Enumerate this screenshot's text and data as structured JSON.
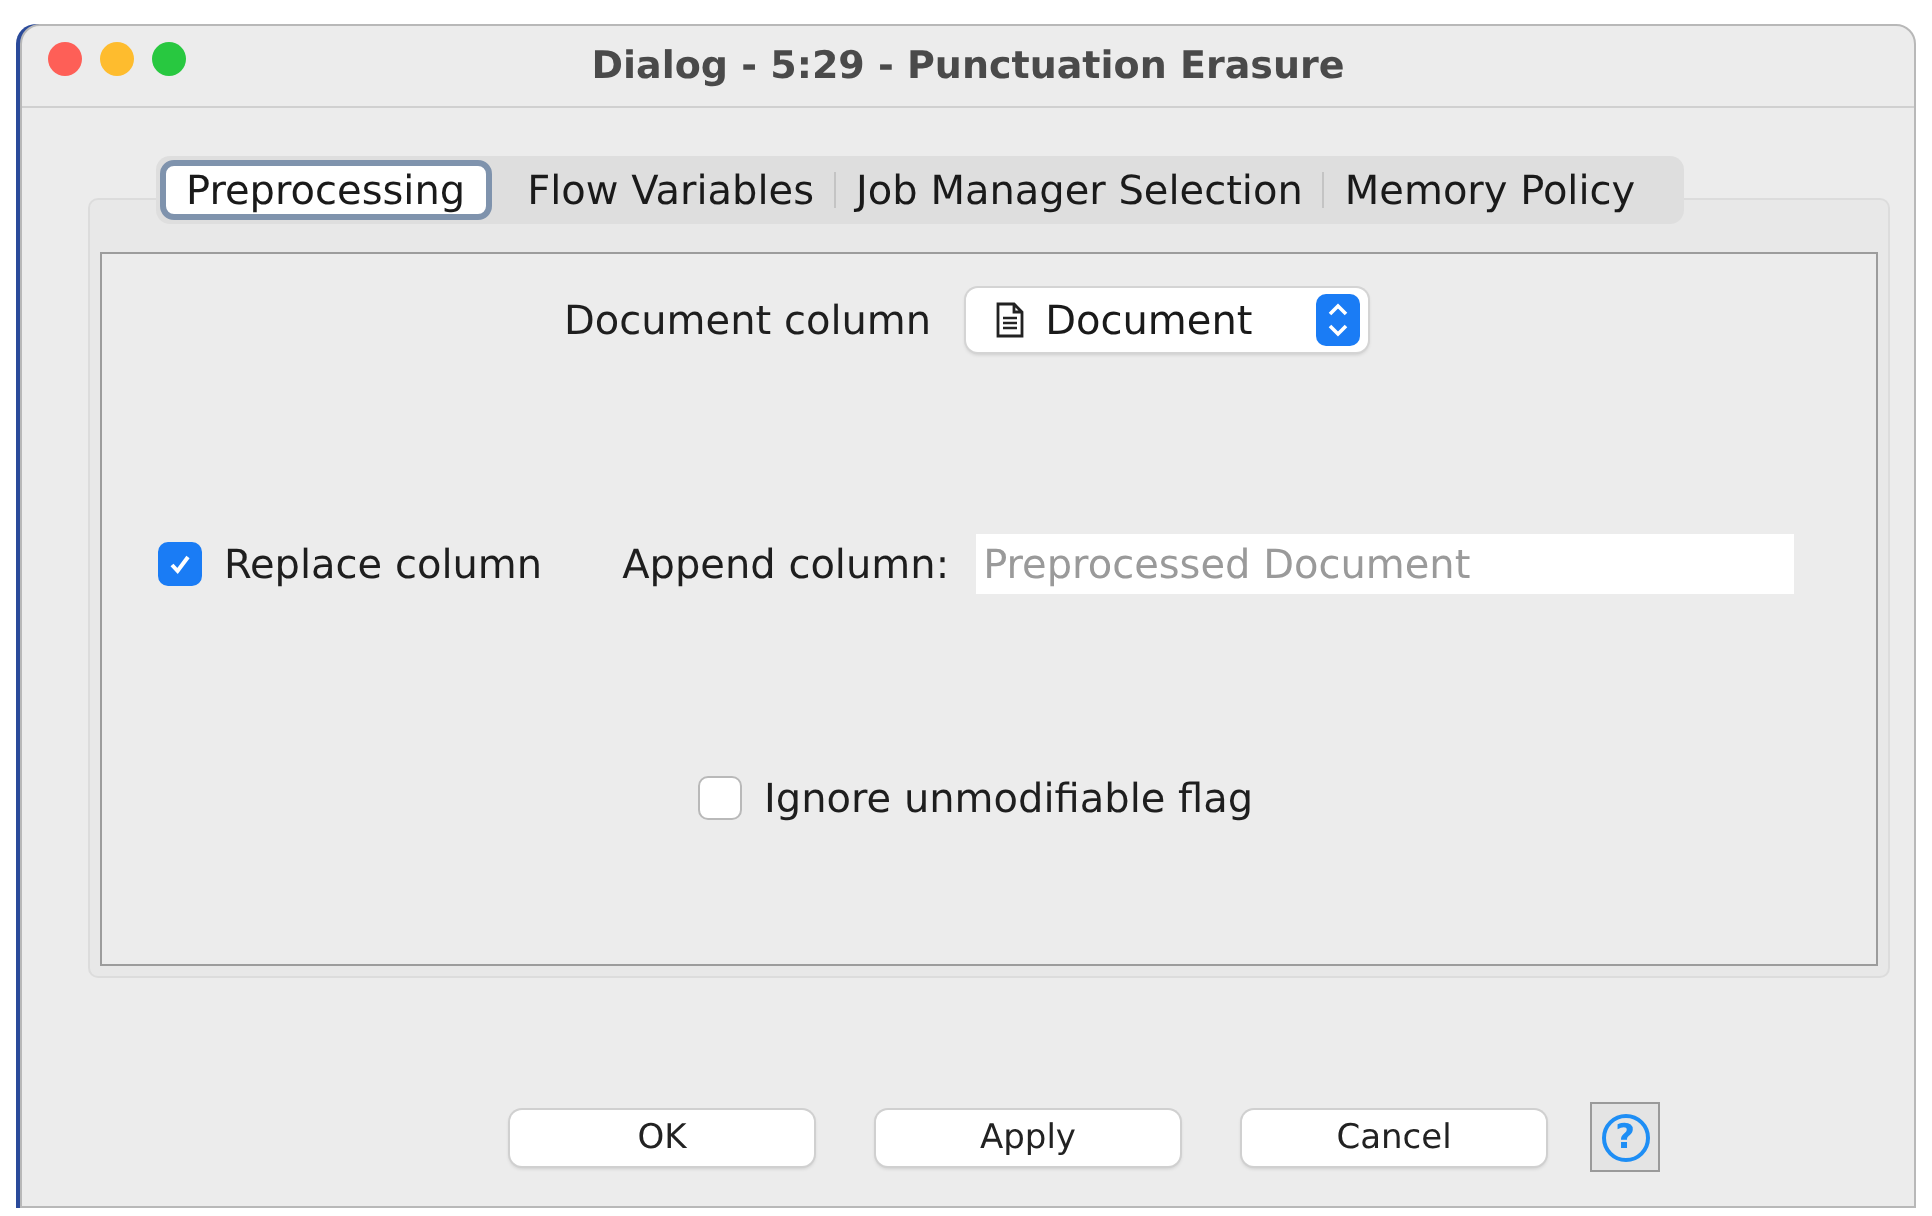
{
  "window": {
    "title": "Dialog - 5:29 - Punctuation Erasure"
  },
  "tabs": [
    {
      "label": "Preprocessing",
      "selected": true
    },
    {
      "label": "Flow Variables",
      "selected": false
    },
    {
      "label": "Job Manager Selection",
      "selected": false
    },
    {
      "label": "Memory Policy",
      "selected": false
    }
  ],
  "document_column": {
    "label": "Document column",
    "value": "Document"
  },
  "replace_column": {
    "label": "Replace column",
    "checked": true
  },
  "append_column": {
    "label": "Append column:",
    "placeholder": "Preprocessed Document"
  },
  "ignore_flag": {
    "label": "Ignore unmodifiable flag",
    "checked": false
  },
  "buttons": [
    {
      "label": "OK"
    },
    {
      "label": "Apply"
    },
    {
      "label": "Cancel"
    }
  ],
  "help": {
    "label": "?"
  }
}
